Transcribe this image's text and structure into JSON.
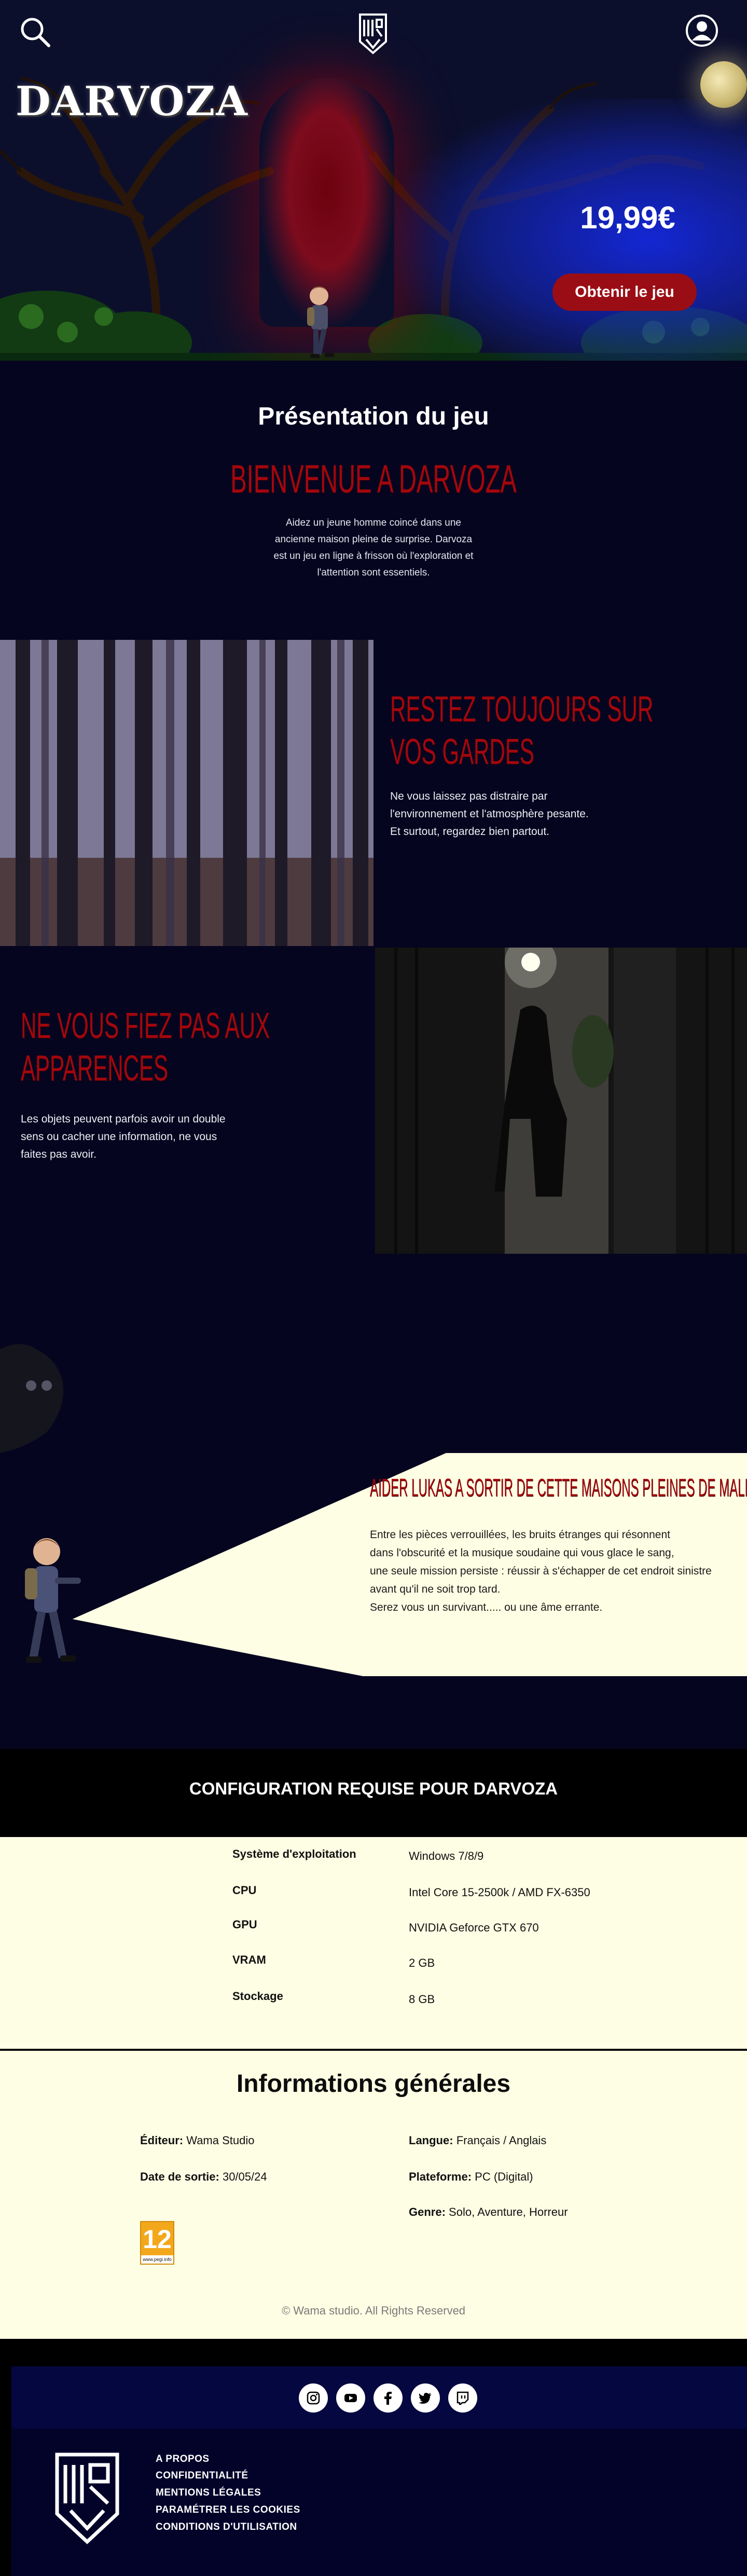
{
  "header": {
    "title": "DARVOZA",
    "price": "19,99€",
    "cta_label": "Obtenir le jeu"
  },
  "presentation": {
    "heading": "Présentation du jeu",
    "tagline": "BIENVENUE A DARVOZA",
    "text": "Aidez un jeune homme coincé dans une ancienne maison pleine de surprise. Darvoza est un jeu en ligne à frisson où l'exploration et l'attention sont essentiels."
  },
  "features": [
    {
      "title_line1": "RESTEZ TOUJOURS SUR",
      "title_line2": "VOS GARDES",
      "text_line1": "Ne vous laissez pas distraire par",
      "text_line2": "l'environnement et l'atmosphère pesante.",
      "text_line3": "Et surtout, regardez bien partout."
    },
    {
      "title_line1": "NE VOUS FIEZ PAS AUX",
      "title_line2": "APPARENCES",
      "text_line1": "Les objets peuvent parfois avoir un double",
      "text_line2": "sens ou cacher une information, ne vous",
      "text_line3": "faites pas avoir."
    }
  ],
  "story": {
    "title": "AIDER LUKAS A SORTIR DE CETTE MAISONS PLEINES DE MALICES",
    "line1": "Entre les pièces verrouillées, les bruits étranges qui résonnent",
    "line2": "dans l'obscurité et la musique soudaine qui vous glace le sang,",
    "line3": "une seule mission persiste : réussir à s'échapper de cet endroit sinistre",
    "line4": "avant qu'il ne soit trop tard.",
    "line5": "Serez vous un survivant..... ou une âme errante."
  },
  "config": {
    "title": "CONFIGURATION REQUISE POUR DARVOZA",
    "rows": [
      {
        "label": "Système d'exploitation",
        "value": "Windows 7/8/9"
      },
      {
        "label": "CPU",
        "value": "Intel Core 15-2500k / AMD FX-6350"
      },
      {
        "label": "GPU",
        "value": "NVIDIA Geforce GTX 670"
      },
      {
        "label": "VRAM",
        "value": "2 GB"
      },
      {
        "label": "Stockage",
        "value": "8 GB"
      }
    ]
  },
  "infos": {
    "title": "Informations générales",
    "editor_label": "Éditeur:",
    "editor_value": "Wama Studio",
    "date_label": "Date de sortie:",
    "date_value": "30/05/24",
    "language_label": "Langue:",
    "language_value": "Français / Anglais",
    "platform_label": "Plateforme:",
    "platform_value": "PC (Digital)",
    "genre_label": "Genre:",
    "genre_value": "Solo, Aventure, Horreur",
    "pegi_number": "12",
    "pegi_site": "www.pegi.info",
    "copyright": "© Wama studio. All Rights Reserved"
  },
  "footer": {
    "social_icons": [
      "instagram-icon",
      "youtube-icon",
      "facebook-icon",
      "twitter-icon",
      "twitch-icon"
    ],
    "links": [
      "A PROPOS",
      "CONFIDENTIALITÉ",
      "MENTIONS LÉGALES",
      "PARAMÉTRER LES COOKIES",
      "CONDITIONS D'UTILISATION"
    ]
  },
  "colors": {
    "background": "#06051f",
    "accent_red": "#a3070d",
    "button_red": "#9b0d14",
    "cream": "#fefee4",
    "footer_band": "#050740"
  }
}
